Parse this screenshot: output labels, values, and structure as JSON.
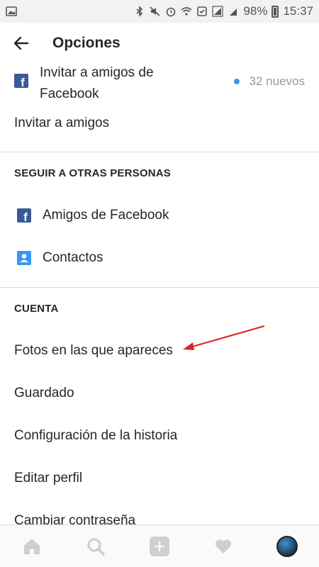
{
  "status_bar": {
    "battery": "98%",
    "time": "15:37"
  },
  "app_bar": {
    "title": "Opciones"
  },
  "invite": {
    "facebook_line1": "Invitar a amigos de",
    "facebook_line2": "Facebook",
    "facebook_badge": "32 nuevos",
    "friends": "Invitar a amigos"
  },
  "follow_section": {
    "header": "SEGUIR A OTRAS PERSONAS",
    "facebook_friends": "Amigos de Facebook",
    "contacts": "Contactos"
  },
  "account_section": {
    "header": "CUENTA",
    "items": [
      "Fotos en las que apareces",
      "Guardado",
      "Configuración de la historia",
      "Editar perfil",
      "Cambiar contraseña"
    ]
  },
  "colors": {
    "facebook": "#3b5998",
    "accent": "#3897f0",
    "annotation_arrow": "#e02020"
  },
  "bottom_nav": [
    "home-icon",
    "search-icon",
    "add-post-icon",
    "activity-heart-icon",
    "profile-avatar"
  ]
}
